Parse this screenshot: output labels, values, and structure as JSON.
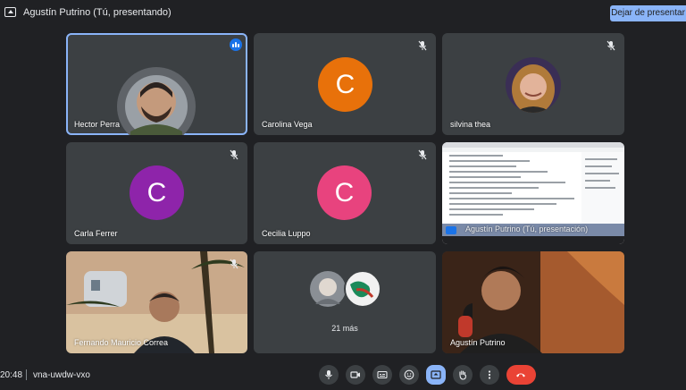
{
  "topbar": {
    "presenting_title": "Agustín Putrino (Tú, presentando)",
    "stop_presenting_label": "Dejar de presentar"
  },
  "tiles": {
    "hector": {
      "name": "Hector Perra"
    },
    "carolina": {
      "name": "Carolina Vega",
      "initial": "C",
      "color": "#e8710a"
    },
    "silvina": {
      "name": "silvina thea"
    },
    "carla": {
      "name": "Carla Ferrer",
      "initial": "C",
      "color": "#8e24aa"
    },
    "cecilia": {
      "name": "Cecilia Luppo",
      "initial": "C",
      "color": "#e8437e"
    },
    "screen": {
      "name": "Agustín Putrino (Tú, presentación)"
    },
    "fernando": {
      "name": "Fernando Mauricio Correa"
    },
    "more": {
      "label": "21 más"
    },
    "agustin": {
      "name": "Agustín Putrino"
    }
  },
  "bottombar": {
    "time": "20:48",
    "meeting_code": "vna-uwdw-vxo"
  },
  "colors": {
    "background": "#202124",
    "tile": "#3c4043",
    "accent": "#8ab4f8",
    "hangup": "#ea4335"
  },
  "icons": [
    "present-screen-icon",
    "mic-off-icon",
    "mic-icon",
    "camera-icon",
    "captions-icon",
    "emoji-icon",
    "present-icon",
    "raise-hand-icon",
    "more-options-icon",
    "hang-up-icon",
    "speaking-indicator-icon"
  ]
}
